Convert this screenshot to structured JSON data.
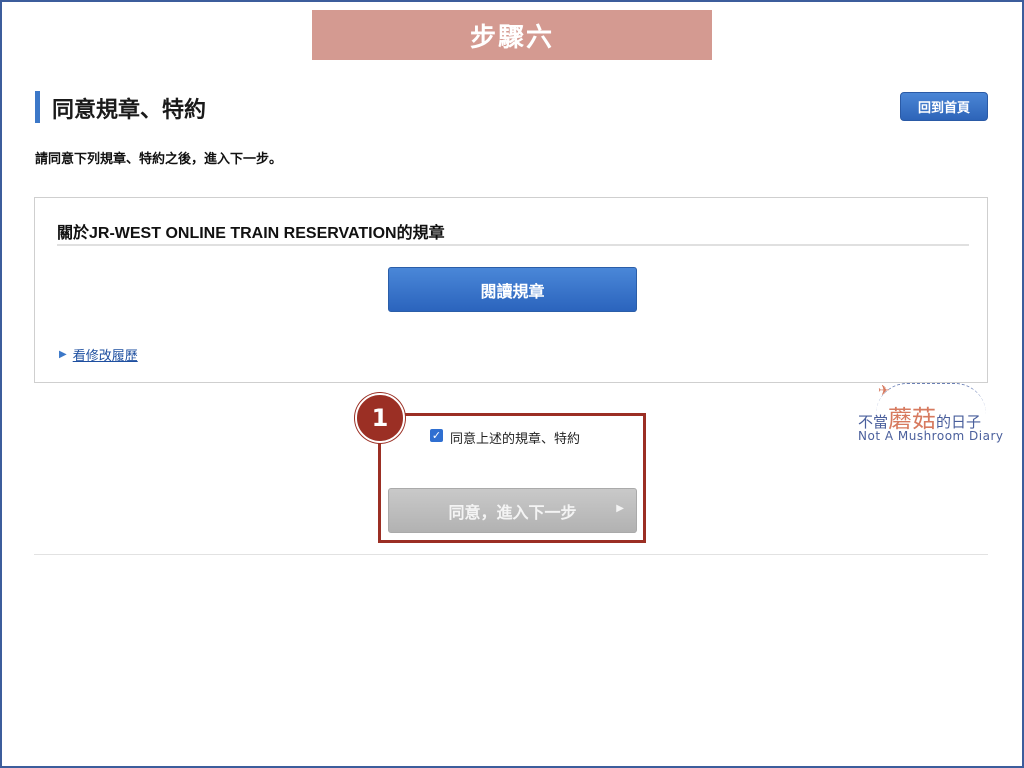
{
  "step_banner": "步驟六",
  "page": {
    "title": "同意規章、特約",
    "home_button": "回到首頁",
    "instruction": "請同意下列規章、特約之後，進入下一步。"
  },
  "terms": {
    "heading": "關於JR-WEST ONLINE TRAIN RESERVATION的規章",
    "read_button": "閱讀規章",
    "history_link": "看修改履歷"
  },
  "agree": {
    "step_number": "1",
    "checkbox_checked": true,
    "checkbox_label": "同意上述的規章、特約",
    "next_button": "同意，進入下一步"
  },
  "watermark": {
    "prefix": "不當",
    "highlight": "蘑菇",
    "suffix": "的日子",
    "english": "Not A Mushroom Diary"
  },
  "colors": {
    "accent": "#3c78c8",
    "banner": "#d49a91",
    "highlight_box": "#9b2f24",
    "disabled_button": "#b8b8b8"
  }
}
